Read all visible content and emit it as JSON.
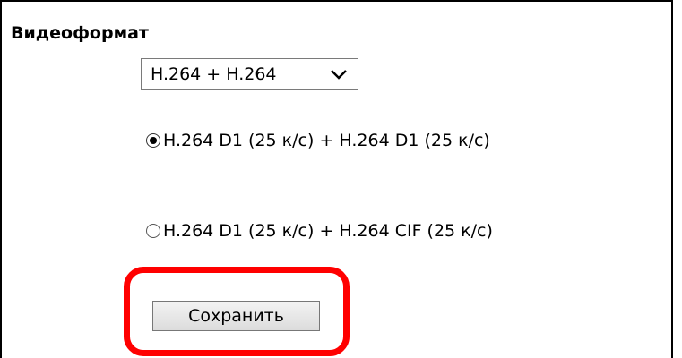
{
  "section": {
    "title": "Видеоформат"
  },
  "format_select": {
    "selected": "H.264 + H.264",
    "chevron_icon": "chevron-down-icon"
  },
  "options": [
    {
      "label": "H.264 D1 (25 к/с) + H.264 D1 (25 к/с)",
      "checked": true
    },
    {
      "label": "H.264 D1 (25 к/с) + H.264 CIF (25 к/с)",
      "checked": false
    }
  ],
  "actions": {
    "save_label": "Сохранить"
  },
  "colors": {
    "highlight": "#ff0000"
  }
}
